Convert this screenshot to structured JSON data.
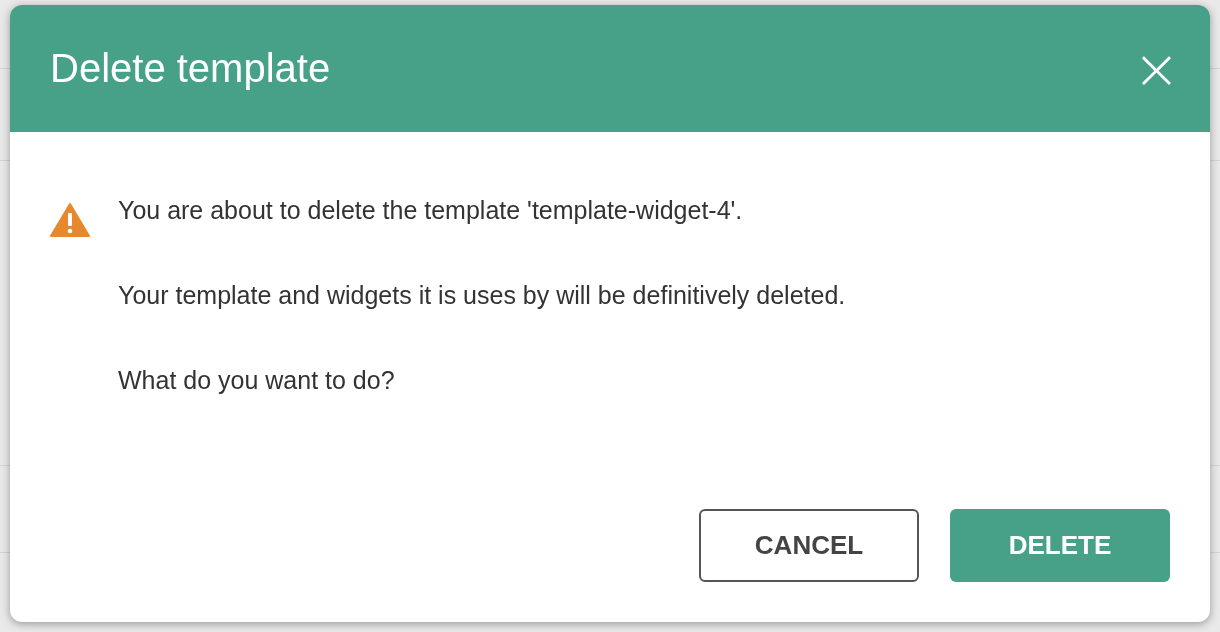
{
  "dialog": {
    "title": "Delete template",
    "close_label": "×",
    "messages": [
      "You are about to delete the template 'template-widget-4'.",
      "Your template and widgets it is uses by will be definitively deleted.",
      "What do you want to do?"
    ],
    "buttons": [
      {
        "label": "CANCEL",
        "kind": "secondary"
      },
      {
        "label": "DELETE",
        "kind": "primary"
      }
    ]
  }
}
